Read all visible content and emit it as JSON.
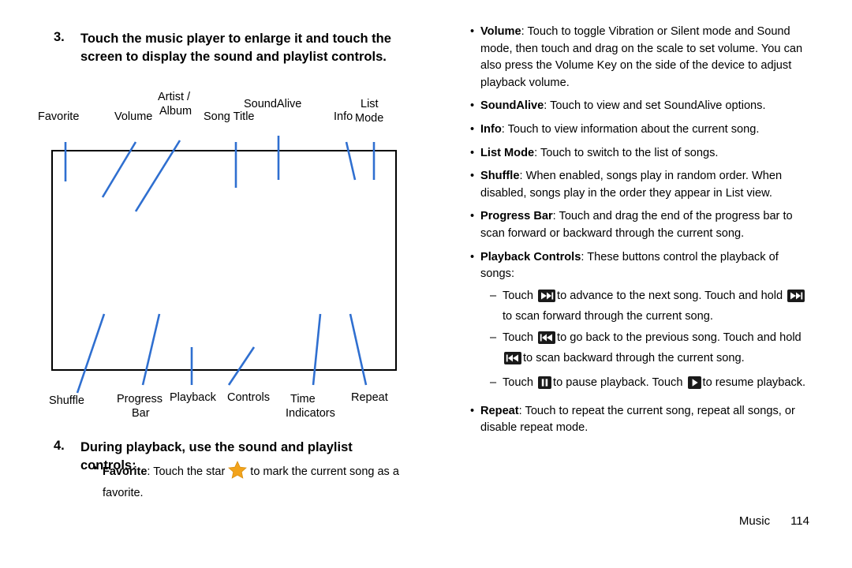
{
  "steps": {
    "step3": {
      "number": "3.",
      "text": "Touch the music player to enlarge it and touch the screen to display the sound and playlist controls."
    },
    "step4": {
      "number": "4.",
      "text": "During playback, use the sound and playlist controls:"
    }
  },
  "favorite_bullet": {
    "dot": "•",
    "lead": "Favorite",
    "text_before_icon": ": Touch the star",
    "icon": "star-icon",
    "text_after_icon": "to mark the current song as a favorite."
  },
  "diagram": {
    "labels": {
      "favorite": "Favorite",
      "volume": "Volume",
      "artist_album_line1": "Artist /",
      "artist_album_line2": "Album",
      "song_title": "Song Title",
      "soundalive": "SoundAlive",
      "info": "Info",
      "list_mode_line1": "List",
      "list_mode_line2": "Mode",
      "shuffle": "Shuffle",
      "progress_line1": "Progress",
      "progress_line2": "Bar",
      "playback": "Playback",
      "controls": "Controls",
      "time_line1": "Time",
      "time_line2": "Indicators",
      "repeat": "Repeat"
    },
    "line_color": "#2f6fd0",
    "box_border_color": "#000000"
  },
  "right_bullets": [
    {
      "dot": "•",
      "lead": "Volume",
      "text": ": Touch to toggle Vibration or Silent mode and Sound mode, then touch and drag on the scale to set volume. You can also press the Volume Key on the side of the device to adjust playback volume."
    },
    {
      "dot": "•",
      "lead": "SoundAlive",
      "text": ": Touch to view and set SoundAlive options."
    },
    {
      "dot": "•",
      "lead": "Info",
      "text": ": Touch to view information about the current song."
    },
    {
      "dot": "•",
      "lead": "List Mode",
      "text": ": Touch to switch to the list of songs."
    },
    {
      "dot": "•",
      "lead": "Shuffle",
      "text": ": When enabled, songs play in random order. When disabled, songs play in the order they appear in List view."
    },
    {
      "dot": "•",
      "lead": "Progress Bar",
      "text": ": Touch and drag the end of the progress bar to scan forward or backward through the current song."
    }
  ],
  "playback_bullet": {
    "dot": "•",
    "lead": "Playback Controls",
    "text": ": These buttons control the playback of songs:"
  },
  "sub_bullets": [
    {
      "dash": "–",
      "segments": [
        {
          "type": "text",
          "value": "Touch"
        },
        {
          "type": "icon",
          "value": "next-track-icon"
        },
        {
          "type": "text",
          "value": "to advance to the next song. Touch and hold"
        },
        {
          "type": "icon",
          "value": "next-track-icon"
        },
        {
          "type": "text",
          "value": "to scan forward through the current song."
        }
      ]
    },
    {
      "dash": "–",
      "segments": [
        {
          "type": "text",
          "value": "Touch"
        },
        {
          "type": "icon",
          "value": "previous-track-icon"
        },
        {
          "type": "text",
          "value": "to go back to the previous song. Touch and hold"
        },
        {
          "type": "icon",
          "value": "previous-track-icon"
        },
        {
          "type": "text",
          "value": "to scan backward through the current song."
        }
      ]
    },
    {
      "dash": "–",
      "segments": [
        {
          "type": "text",
          "value": "Touch"
        },
        {
          "type": "icon",
          "value": "pause-icon"
        },
        {
          "type": "text",
          "value": "to pause playback. Touch"
        },
        {
          "type": "icon",
          "value": "play-icon"
        },
        {
          "type": "text",
          "value": "to resume playback."
        }
      ]
    }
  ],
  "repeat_bullet": {
    "dot": "•",
    "lead": "Repeat",
    "text": ": Touch to repeat the current song, repeat all songs, or disable repeat mode."
  },
  "footer": {
    "label": "Music",
    "page": "114"
  },
  "colors": {
    "star": "#f2a31b",
    "diagram_line": "#2f6fd0",
    "text": "#000000"
  }
}
